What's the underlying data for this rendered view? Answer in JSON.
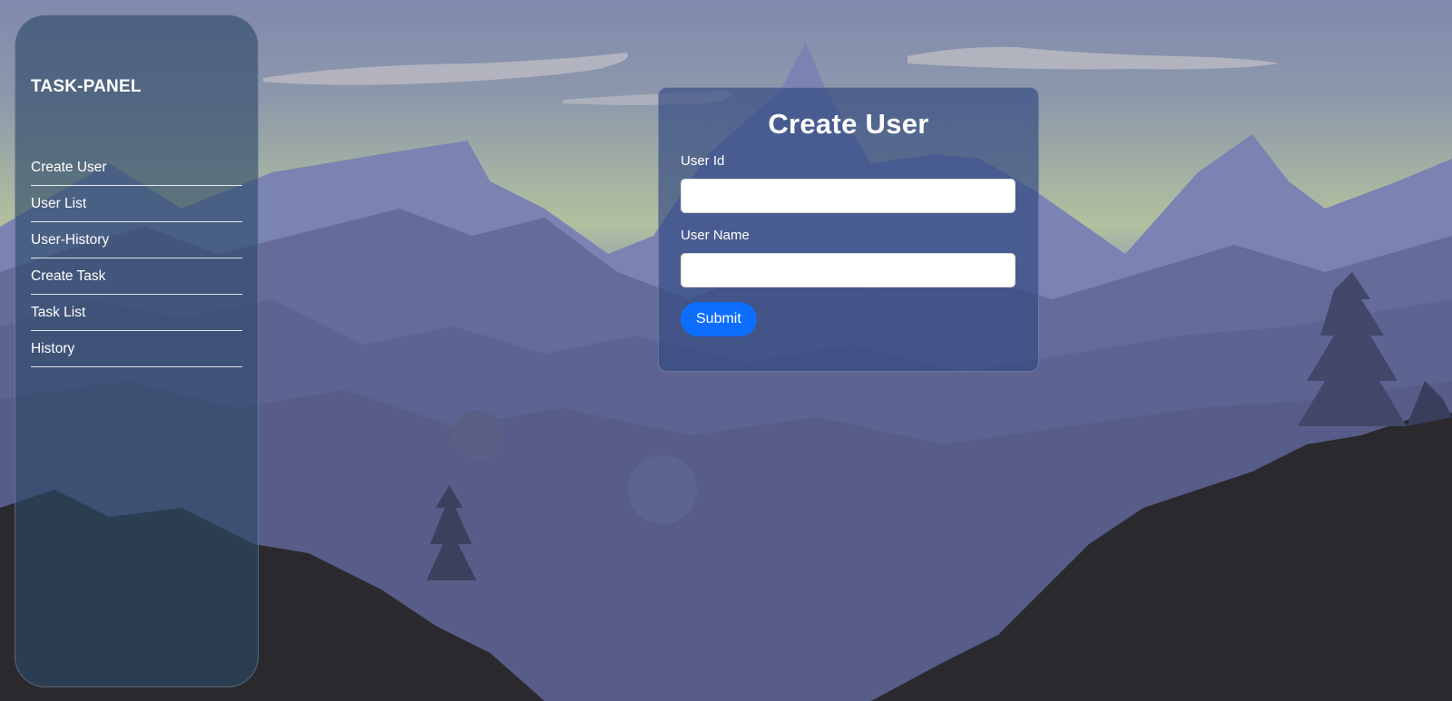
{
  "sidebar": {
    "title": "TASK-PANEL",
    "items": [
      {
        "label": "Create User"
      },
      {
        "label": "User List"
      },
      {
        "label": "User-History"
      },
      {
        "label": "Create Task"
      },
      {
        "label": "Task List"
      },
      {
        "label": "History"
      }
    ]
  },
  "form": {
    "title": "Create User",
    "fields": [
      {
        "label": "User Id",
        "value": "",
        "placeholder": ""
      },
      {
        "label": "User Name",
        "value": "",
        "placeholder": ""
      }
    ],
    "submit_label": "Submit"
  },
  "colors": {
    "accent": "#0d6efd",
    "panel": "#2c4868",
    "text": "#ffffff"
  },
  "background": {
    "icon": "mountain-landscape"
  }
}
